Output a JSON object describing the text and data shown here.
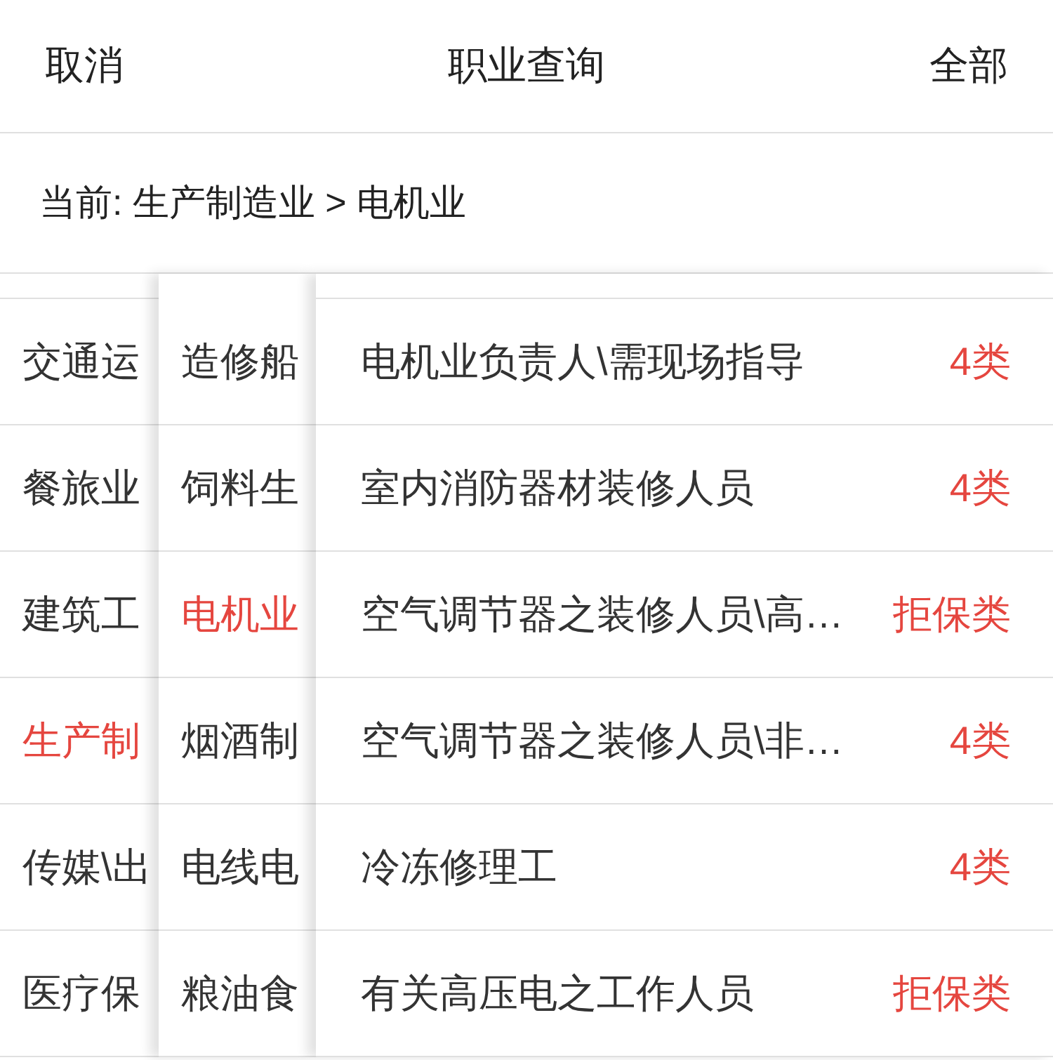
{
  "header": {
    "cancel": "取消",
    "title": "职业查询",
    "all": "全部"
  },
  "breadcrumb": "当前: 生产制造业 > 电机业",
  "categories": [
    {
      "label": "交通运",
      "selected": false
    },
    {
      "label": "餐旅业",
      "selected": false
    },
    {
      "label": "建筑工",
      "selected": false
    },
    {
      "label": "生产制",
      "selected": true
    },
    {
      "label": "传媒\\出",
      "selected": false
    },
    {
      "label": "医疗保",
      "selected": false
    }
  ],
  "subcategories": [
    {
      "label": "造修船",
      "selected": false
    },
    {
      "label": "饲料生",
      "selected": false
    },
    {
      "label": "电机业",
      "selected": true
    },
    {
      "label": "烟酒制",
      "selected": false
    },
    {
      "label": "电线电",
      "selected": false
    },
    {
      "label": "粮油食",
      "selected": false
    }
  ],
  "occupations": [
    {
      "name": "电机业负责人\\需现场指导",
      "class": "4类"
    },
    {
      "name": "室内消防器材装修人员",
      "class": "4类"
    },
    {
      "name": "空气调节器之装修人员\\高…",
      "class": "拒保类"
    },
    {
      "name": "空气调节器之装修人员\\非…",
      "class": "4类"
    },
    {
      "name": "冷冻修理工",
      "class": "4类"
    },
    {
      "name": "有关高压电之工作人员",
      "class": "拒保类"
    }
  ]
}
